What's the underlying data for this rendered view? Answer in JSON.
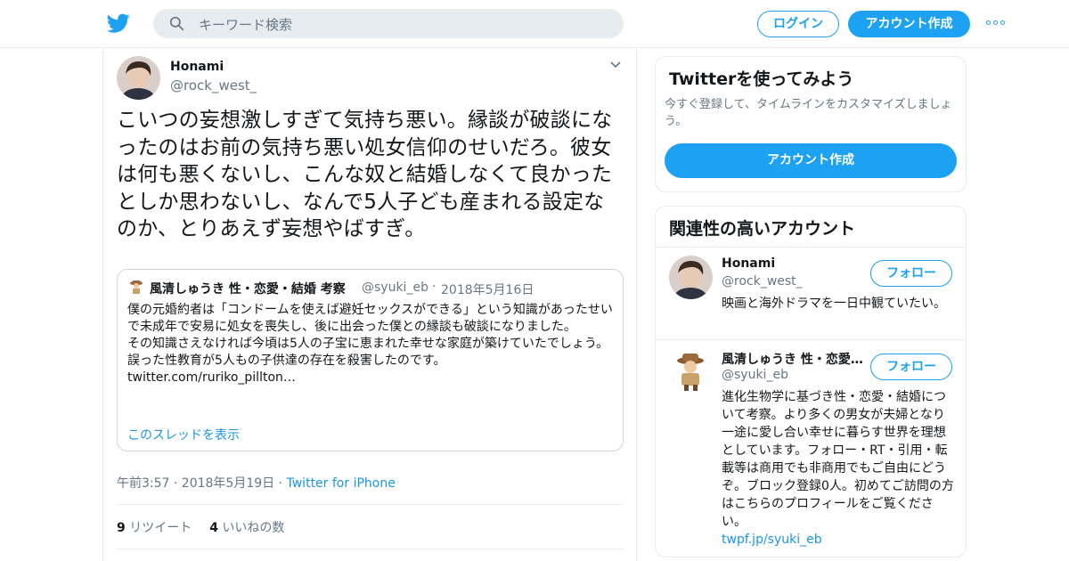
{
  "topbar": {
    "search_placeholder": "キーワード検索",
    "login_label": "ログイン",
    "signup_label": "アカウント作成"
  },
  "tweet": {
    "author_name": "Honami",
    "author_handle": "@rock_west_",
    "text": "こいつの妄想激しすぎて気持ち悪い。縁談が破談になったのはお前の気持ち悪い処女信仰のせいだろ。彼女は何も悪くないし、こんな奴と結婚しなくて良かったとしか思わないし、なんで5人子ども産まれる設定なのか、とりあえず妄想やばすぎ。",
    "quote": {
      "name": "風清しゅうき 性・恋愛・結婚 考察",
      "handle": "@syuki_eb",
      "separator": "·",
      "date": "2018年5月16日",
      "text": "僕の元婚約者は「コンドームを使えば避妊セックスができる」という知識があったせいで未成年で安易に処女を喪失し、後に出会った僕との縁談も破談になりました。\nその知識さえなければ今頃は5人の子宝に恵まれた幸せな家庭が築けていたでしょう。\n誤った性教育が5人もの子供達の存在を殺害したのです。",
      "link": "twitter.com/ruriko_pillton…",
      "thread_label": "このスレッドを表示"
    },
    "timestamp": "午前3:57 · 2018年5月19日",
    "separator": "·",
    "source": "Twitter for iPhone",
    "retweet_count": "9",
    "retweet_label": "リツイート",
    "like_count": "4",
    "like_label": "いいねの数"
  },
  "signup_card": {
    "title": "Twitterを使ってみよう",
    "subtitle": "今すぐ登録して、タイムラインをカスタマイズしましょう。",
    "button_label": "アカウント作成"
  },
  "related": {
    "title": "関連性の高いアカウント",
    "accounts": [
      {
        "name": "Honami",
        "handle": "@rock_west_",
        "follow_label": "フォロー",
        "bio": "映画と海外ドラマを一日中観ていたい。",
        "link": ""
      },
      {
        "name": "風清しゅうき 性・恋愛・結婚 考察",
        "handle": "@syuki_eb",
        "follow_label": "フォロー",
        "bio": "進化生物学に基づき性・恋愛・結婚について考察。より多くの男女が夫婦となり一途に愛し合い幸せに暮らす世界を理想としています。フォロー・RT・引用・転載等は商用でも非商用でもご自由にどうぞ。ブロック登録0人。初めてご訪問の方はこちらのプロフィールをご覧ください。",
        "link": "twpf.jp/syuki_eb"
      }
    ]
  },
  "colors": {
    "accent": "#1da1f2",
    "link": "#1b95e0",
    "muted": "#657786",
    "border": "#e6ecf0"
  },
  "icons": [
    "twitter-bird-icon",
    "search-icon",
    "more-icon",
    "chevron-down-icon"
  ]
}
